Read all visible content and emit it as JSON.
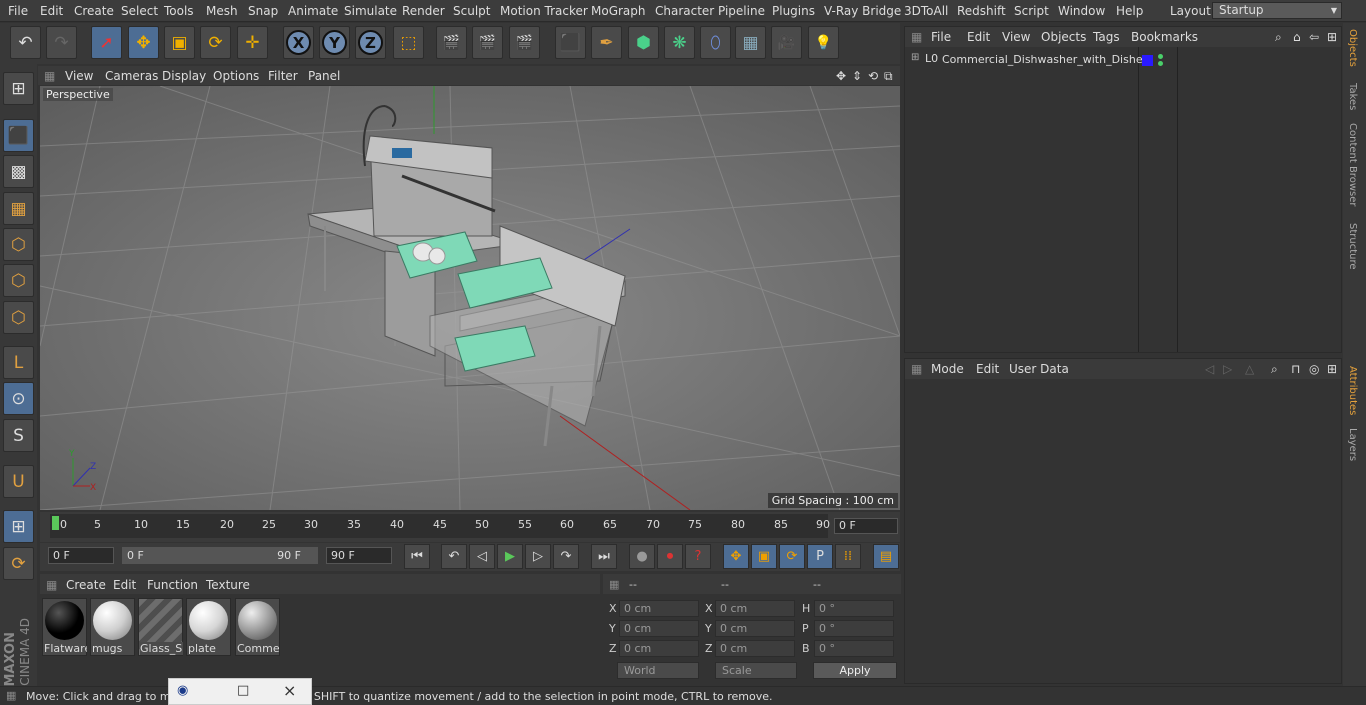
{
  "menubar": {
    "items": [
      "File",
      "Edit",
      "Create",
      "Select",
      "Tools",
      "Mesh",
      "Snap",
      "Animate",
      "Simulate",
      "Render",
      "Sculpt",
      "Motion Tracker",
      "MoGraph",
      "Character",
      "Pipeline",
      "Plugins",
      "V-Ray Bridge",
      "3DToAll",
      "Redshift",
      "Script",
      "Window",
      "Help"
    ],
    "layout_label": "Layout:",
    "layout_value": "Startup"
  },
  "toolbar": {
    "undo": "↶",
    "redo": "↷",
    "select": "➚",
    "move": "✥",
    "scale": "▣",
    "rotate": "⟳",
    "move2": "✛",
    "x": "X",
    "y": "Y",
    "z": "Z",
    "coord": "⬚",
    "render_view": "🎬",
    "render_picture": "🎬",
    "render_settings": "🎬",
    "cube": "⬛",
    "pen": "✒",
    "subdiv": "⬢",
    "mograph": "❋",
    "deformer": "⬯",
    "floor": "▦",
    "camera": "🎥",
    "light": "💡"
  },
  "left_toolbar": {
    "make_editable": "⊞",
    "model": "⬛",
    "texture": "▩",
    "workplane": "▦",
    "points": "⬡",
    "edges": "⬡",
    "polygons": "⬡",
    "axis": "L",
    "tweak": "⊙",
    "snap": "S",
    "magnet": "U",
    "locked": "⊞",
    "rotate_lock": "⟳"
  },
  "viewport": {
    "menu": [
      "View",
      "Cameras",
      "Display",
      "Options",
      "Filter",
      "Panel"
    ],
    "camera_label": "Perspective",
    "grid_spacing": "Grid Spacing : 100 cm"
  },
  "timeline": {
    "ticks": [
      "0",
      "5",
      "10",
      "15",
      "20",
      "25",
      "30",
      "35",
      "40",
      "45",
      "50",
      "55",
      "60",
      "65",
      "70",
      "75",
      "80",
      "85",
      "90"
    ],
    "current_frame": "0 F"
  },
  "transport": {
    "start_field": "0 F",
    "range_start": "0 F",
    "range_end": "90 F",
    "end_field": "90 F"
  },
  "materials": {
    "menu": [
      "Create",
      "Edit",
      "Function",
      "Texture"
    ],
    "items": [
      {
        "name": "Flatware",
        "color": "#050505"
      },
      {
        "name": "mugs",
        "color": "#cfcfcf"
      },
      {
        "name": "Glass_Si",
        "color": "#6d6d6d"
      },
      {
        "name": "plate",
        "color": "#d6d6d6"
      },
      {
        "name": "Commer",
        "color": "#9a9a9a"
      }
    ]
  },
  "coordinates": {
    "headers": [
      "--",
      "--",
      "--"
    ],
    "rows": [
      {
        "l1": "X",
        "v1": "0 cm",
        "l2": "X",
        "v2": "0 cm",
        "l3": "H",
        "v3": "0 °"
      },
      {
        "l1": "Y",
        "v1": "0 cm",
        "l2": "Y",
        "v2": "0 cm",
        "l3": "P",
        "v3": "0 °"
      },
      {
        "l1": "Z",
        "v1": "0 cm",
        "l2": "Z",
        "v2": "0 cm",
        "l3": "B",
        "v3": "0 °"
      }
    ],
    "world": "World",
    "scale": "Scale",
    "apply": "Apply"
  },
  "objects": {
    "menu": [
      "File",
      "Edit",
      "View",
      "Objects",
      "Tags",
      "Bookmarks"
    ],
    "root_name": "Commercial_Dishwasher_with_Dishes",
    "layer_color": "#2a1aff"
  },
  "attributes": {
    "menu": [
      "Mode",
      "Edit",
      "User Data"
    ]
  },
  "side_tabs": [
    "Objects",
    "Takes",
    "Content Browser",
    "Structure",
    "Attributes",
    "Layers"
  ],
  "status": {
    "text": "Move: Click and drag to move elements. Hold down SHIFT to quantize movement / add to the selection in point mode, CTRL to remove."
  },
  "popup": {
    "icons": [
      "◉",
      "□",
      "×"
    ]
  },
  "branding": {
    "line1": "MAXON",
    "line2": "CINEMA 4D"
  }
}
